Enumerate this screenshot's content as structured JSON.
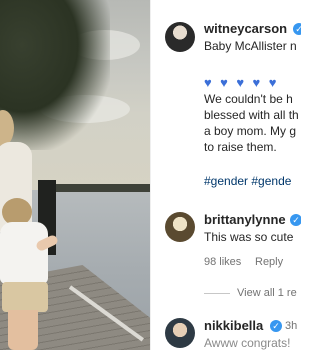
{
  "post_comments": {
    "author": {
      "username": "witneycarson",
      "caption_line": "Baby McAllister n",
      "hearts": [
        "blue-heart",
        "blue-heart",
        "blue-heart",
        "blue-heart",
        "blue-heart"
      ],
      "body_lines": [
        "We couldn't be h",
        "blessed with all th",
        "a boy mom. My g",
        "to raise them."
      ],
      "hashtags": "#gender #gende"
    },
    "comments": [
      {
        "username": "brittanylynne",
        "text": "This was so cute",
        "likes": "98 likes",
        "reply": "Reply",
        "view_replies": "View all 1 re"
      },
      {
        "username": "nikkibella",
        "time": "3h",
        "text": "Awww congrats!"
      }
    ]
  },
  "colors": {
    "verified": "#3797f0",
    "hashtag": "#00376b",
    "heart": "#3b6fd8",
    "meta": "#737373"
  }
}
